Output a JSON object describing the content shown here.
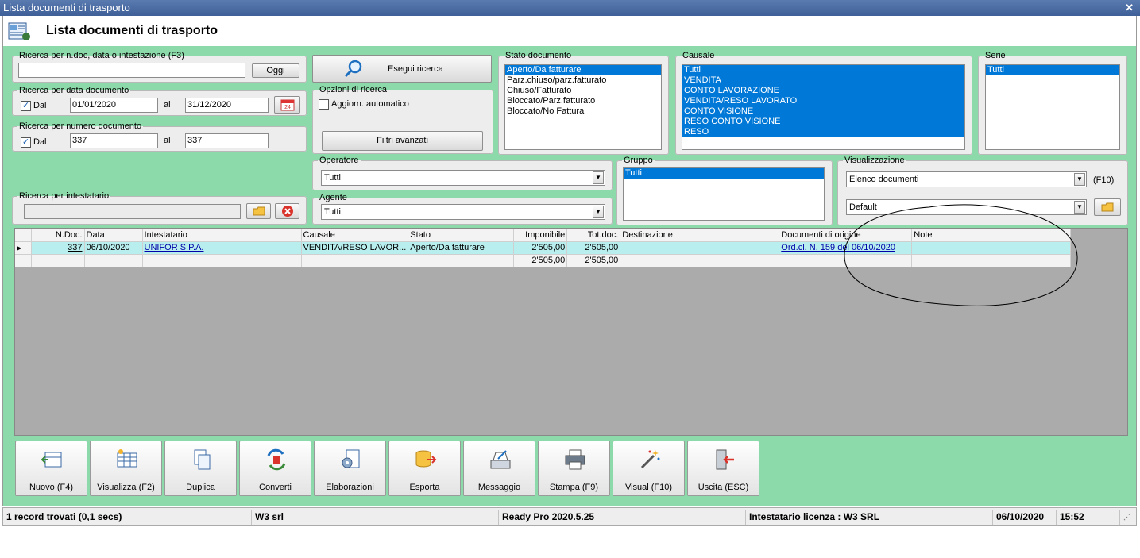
{
  "window": {
    "title": "Lista documenti di trasporto",
    "heading": "Lista documenti di trasporto"
  },
  "search_text": {
    "legend": "Ricerca per n.doc, data o intestazione (F3)",
    "value": "",
    "today_button": "Oggi"
  },
  "search_date": {
    "legend": "Ricerca per data documento",
    "checkbox_label": "Dal",
    "from": "01/01/2020",
    "to_label": "al",
    "to": "31/12/2020",
    "calendar_text": "24"
  },
  "search_number": {
    "legend": "Ricerca per numero documento",
    "checkbox_label": "Dal",
    "from": "337",
    "to_label": "al",
    "to": "337"
  },
  "search_holder": {
    "legend": "Ricerca per intestatario",
    "value": ""
  },
  "run_search_label": "Esegui ricerca",
  "search_options": {
    "legend": "Opzioni di ricerca",
    "auto_update_label": "Aggiorn. automatico",
    "advanced_filters_label": "Filtri avanzati"
  },
  "doc_state": {
    "legend": "Stato documento",
    "items": [
      {
        "label": "Aperto/Da fatturare",
        "selected": true
      },
      {
        "label": "Parz.chiuso/parz.fatturato",
        "selected": false
      },
      {
        "label": "Chiuso/Fatturato",
        "selected": false
      },
      {
        "label": "Bloccato/Parz.fatturato",
        "selected": false
      },
      {
        "label": "Bloccato/No Fattura",
        "selected": false
      }
    ]
  },
  "causale": {
    "legend": "Causale",
    "items": [
      {
        "label": "Tutti",
        "selected": true
      },
      {
        "label": "VENDITA",
        "selected": true
      },
      {
        "label": "CONTO LAVORAZIONE",
        "selected": true
      },
      {
        "label": "VENDITA/RESO LAVORATO",
        "selected": true
      },
      {
        "label": "CONTO VISIONE",
        "selected": true
      },
      {
        "label": "RESO CONTO VISIONE",
        "selected": true
      },
      {
        "label": "RESO",
        "selected": true
      }
    ]
  },
  "serie": {
    "legend": "Serie",
    "items": [
      {
        "label": "Tutti",
        "selected": true
      }
    ]
  },
  "operatore": {
    "legend": "Operatore",
    "value": "Tutti"
  },
  "agente": {
    "legend": "Agente",
    "value": "Tutti"
  },
  "gruppo": {
    "legend": "Gruppo",
    "items": [
      {
        "label": "Tutti",
        "selected": true
      }
    ]
  },
  "visualizzazione": {
    "legend": "Visualizzazione",
    "view_value": "Elenco documenti",
    "shortcut": "(F10)",
    "layout_value": "Default"
  },
  "grid": {
    "columns": [
      "N.Doc.",
      "Data",
      "Intestatario",
      "Causale",
      "Stato",
      "Imponibile",
      "Tot.doc.",
      "Destinazione",
      "Documenti di origine",
      "Note"
    ],
    "rows": [
      {
        "ndoc": "337",
        "data": "06/10/2020",
        "intestatario": "UNIFOR S.P.A.",
        "causale": "VENDITA/RESO LAVOR...",
        "stato": "Aperto/Da fatturare",
        "imponibile": "2'505,00",
        "totdoc": "2'505,00",
        "destinazione": "",
        "origine": "Ord.cl. N. 159 del 06/10/2020",
        "note": ""
      }
    ],
    "totals": {
      "imponibile": "2'505,00",
      "totdoc": "2'505,00"
    }
  },
  "toolbar": [
    {
      "name": "new",
      "label": "Nuovo (F4)"
    },
    {
      "name": "view",
      "label": "Visualizza (F2)"
    },
    {
      "name": "duplicate",
      "label": "Duplica"
    },
    {
      "name": "convert",
      "label": "Converti"
    },
    {
      "name": "process",
      "label": "Elaborazioni"
    },
    {
      "name": "export",
      "label": "Esporta"
    },
    {
      "name": "message",
      "label": "Messaggio"
    },
    {
      "name": "print",
      "label": "Stampa (F9)"
    },
    {
      "name": "visual",
      "label": "Visual (F10)"
    },
    {
      "name": "exit",
      "label": "Uscita (ESC)"
    }
  ],
  "status": {
    "records": "1 record trovati (0,1 secs)",
    "company": "W3 srl",
    "version": "Ready Pro 2020.5.25",
    "license": "Intestatario licenza : W3 SRL",
    "date": "06/10/2020",
    "time": "15:52"
  }
}
